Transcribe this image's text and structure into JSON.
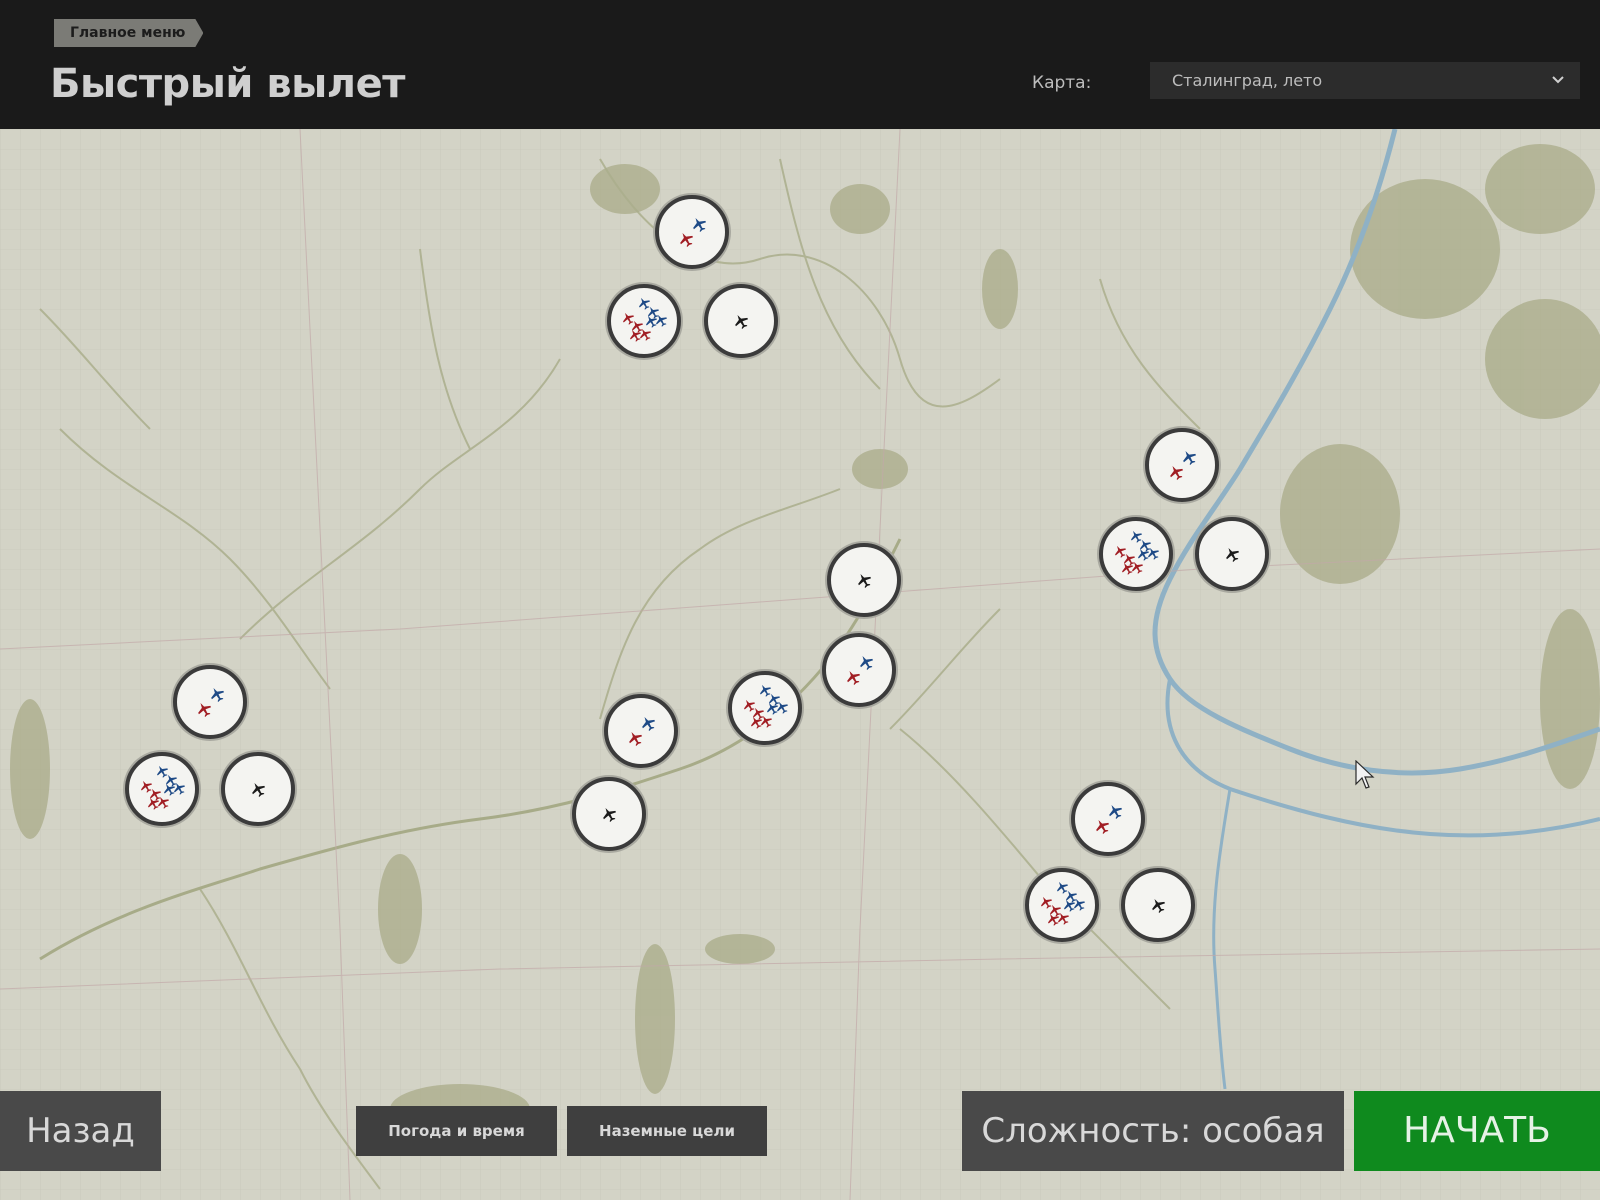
{
  "header": {
    "breadcrumb": "Главное меню",
    "title": "Быстрый вылет",
    "map_label": "Карта:",
    "map_select_value": "Сталинград, лето"
  },
  "footer": {
    "back_label": "Назад",
    "weather_label": "Погода и время",
    "ground_targets_label": "Наземные цели",
    "difficulty_label": "Сложность: особая",
    "start_label": "НАЧАТЬ"
  },
  "colors": {
    "header_bg": "#1a1a1a",
    "map_bg": "#d3d3c6",
    "river": "#8db0c6",
    "forest": "#a8ab85",
    "red_plane": "#a11e24",
    "blue_plane": "#1e4a86",
    "neutral_plane": "#1b1b1b",
    "start_button": "#0f8a1e"
  },
  "markers": [
    {
      "kind": "mixed"
    },
    {
      "kind": "battle"
    },
    {
      "kind": "neutral"
    },
    {
      "kind": "mixed"
    },
    {
      "kind": "battle"
    },
    {
      "kind": "neutral"
    },
    {
      "kind": "neutral"
    },
    {
      "kind": "mixed"
    },
    {
      "kind": "battle"
    },
    {
      "kind": "mixed"
    },
    {
      "kind": "neutral"
    },
    {
      "kind": "mixed"
    },
    {
      "kind": "battle"
    },
    {
      "kind": "neutral"
    },
    {
      "kind": "mixed"
    },
    {
      "kind": "battle"
    },
    {
      "kind": "neutral"
    }
  ]
}
